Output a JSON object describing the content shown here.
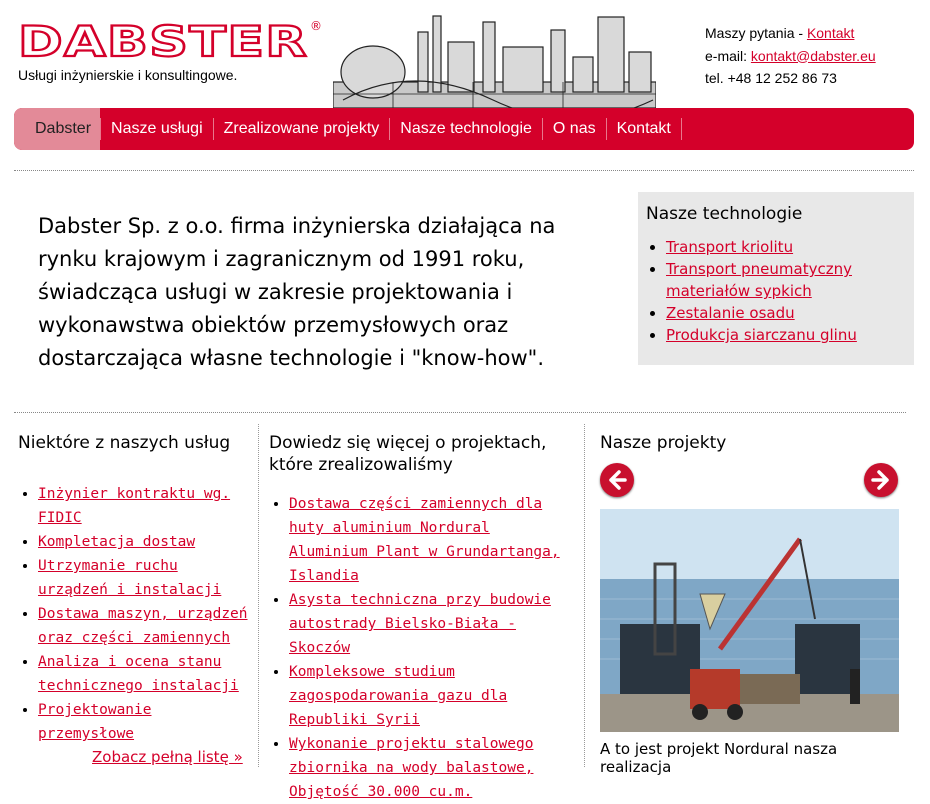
{
  "header": {
    "logo_text": "DABSTER",
    "tagline": "Usługi inżynierskie i konsultingowe.",
    "contact": {
      "questions_label": "Maszy pytania - ",
      "questions_link": "Kontakt",
      "email_label": "e-mail: ",
      "email": "kontakt@dabster.eu",
      "phone": "tel. +48 12 252 86 73"
    }
  },
  "nav": {
    "items": [
      "Dabster",
      "Nasze usługi",
      "Zrealizowane projekty",
      "Nasze technologie",
      "O nas",
      "Kontakt"
    ]
  },
  "intro": {
    "text": "Dabster Sp. z o.o. firma inżynierska działająca na rynku krajowym i zagranicznym od 1991 roku, świadcząca usługi w zakresie projektowania i wykonawstwa obiektów przemysłowych oraz dostarczająca własne technologie i \"know-how\"."
  },
  "technologies": {
    "title": "Nasze technologie",
    "items": [
      "Transport kriolitu",
      "Transport pneumatyczny materiałów sypkich",
      "Zestalanie osadu",
      "Produkcja siarczanu glinu"
    ]
  },
  "services": {
    "title": "Niektóre z naszych usług",
    "items": [
      "Inżynier kontraktu wg. FIDIC",
      "Kompletacja dostaw",
      "Utrzymanie ruchu urządzeń i instalacji",
      "Dostawa maszyn, urządzeń oraz części zamiennych",
      "Analiza i ocena stanu technicznego instalacji",
      "Projektowanie przemysłowe"
    ],
    "see_all": "Zobacz pełną listę »"
  },
  "projects_info": {
    "title": "Dowiedz się więcej o projektach, które zrealizowaliśmy",
    "items": [
      "Dostawa części zamiennych dla huty aluminium Nordural Aluminium Plant w Grundartanga, Islandia",
      "Asysta techniczna przy budowie autostrady Bielsko-Biała - Skoczów",
      "Kompleksowe studium zagospodarowania gazu dla Republiki Syrii",
      "Wykonanie projektu stalowego zbiornika na wody balastowe, Objętość 30.000 cu.m."
    ]
  },
  "gallery": {
    "title": "Nasze projekty",
    "caption": "A to jest projekt Nordural nasza realizacja"
  },
  "colors": {
    "brand_red": "#d4002a",
    "nav_active": "#e38a98",
    "box_gray": "#e8e8e8"
  },
  "icons": [
    "prev-arrow-icon",
    "next-arrow-icon",
    "registered-icon"
  ]
}
